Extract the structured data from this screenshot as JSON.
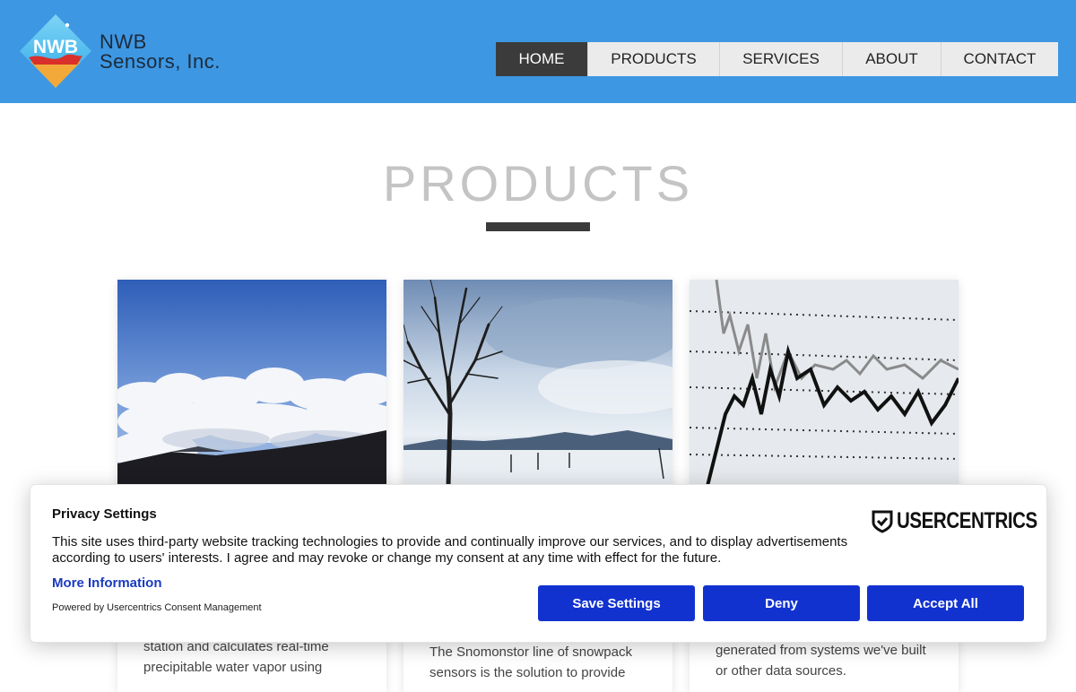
{
  "brand": {
    "line1": "NWB",
    "line2": "Sensors, Inc.",
    "logo_text": "NWB"
  },
  "nav": [
    {
      "label": "HOME",
      "active": true
    },
    {
      "label": "PRODUCTS",
      "active": false
    },
    {
      "label": "SERVICES",
      "active": false
    },
    {
      "label": "ABOUT",
      "active": false
    },
    {
      "label": "CONTACT",
      "active": false
    }
  ],
  "page": {
    "title": "PRODUCTS"
  },
  "cards": [
    {
      "image": "clouds-above-mountain-photo",
      "text_line1": "station and calculates real-time",
      "text_line2": "precipitable water vapor using"
    },
    {
      "image": "snowy-field-tree-photo",
      "text_line1": "The Snomonstor line of snowpack",
      "text_line2": "sensors is the solution to provide"
    },
    {
      "image": "data-chart-photo",
      "text_line1": "generated from systems we've built",
      "text_line2": "or other data sources."
    }
  ],
  "consent": {
    "title": "Privacy Settings",
    "body": "This site uses third-party website tracking technologies to provide and continually improve our services, and to display advertisements according to users' interests. I agree and may revoke or change my consent at any time with effect for the future.",
    "more_info": "More Information",
    "powered_by": "Powered by Usercentrics Consent Management",
    "logo_text": "USERCENTRICS",
    "buttons": {
      "save": "Save Settings",
      "deny": "Deny",
      "accept": "Accept All"
    }
  },
  "colors": {
    "header_bg": "#3d97e3",
    "nav_active_bg": "#3b3b3b",
    "button_bg": "#1232d0"
  }
}
